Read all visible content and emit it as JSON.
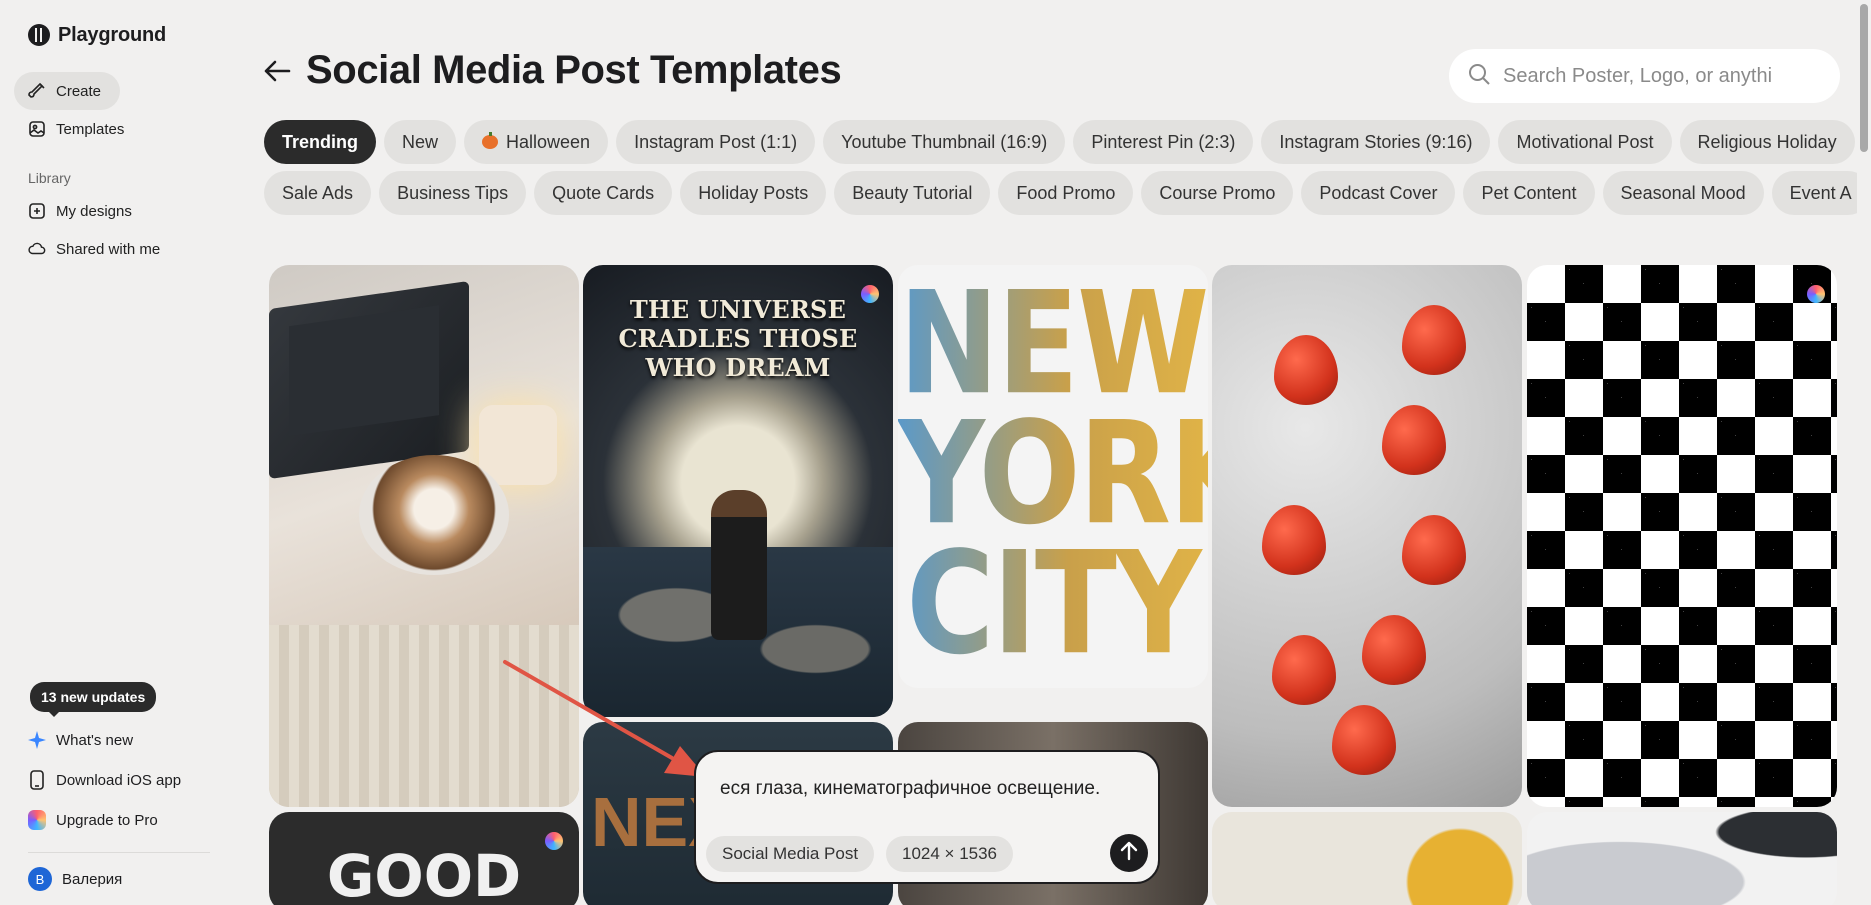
{
  "brand": {
    "name": "Playground"
  },
  "sidebar": {
    "create_label": "Create",
    "templates_label": "Templates",
    "library_label": "Library",
    "my_designs_label": "My designs",
    "shared_label": "Shared with me",
    "updates_badge": "13 new updates",
    "whats_new_label": "What's new",
    "ios_label": "Download iOS app",
    "upgrade_label": "Upgrade to Pro",
    "user": {
      "initial": "B",
      "name": "Валерия"
    }
  },
  "header": {
    "title": "Social Media Post Templates"
  },
  "search": {
    "placeholder": "Search Poster, Logo, or anythi"
  },
  "chips_row1": [
    "Trending",
    "New",
    "Halloween",
    "Instagram Post (1:1)",
    "Youtube Thumbnail (16:9)",
    "Pinterest Pin (2:3)",
    "Instagram Stories (9:16)",
    "Motivational Post",
    "Religious Holiday"
  ],
  "chips_row2": [
    "Sale Ads",
    "Business Tips",
    "Quote Cards",
    "Holiday Posts",
    "Beauty Tutorial",
    "Food Promo",
    "Course Promo",
    "Podcast Cover",
    "Pet Content",
    "Seasonal Mood",
    "Event A"
  ],
  "active_chip": "Trending",
  "cards": {
    "universe_title": "THE UNIVERSE CRADLES THOSE WHO DREAM",
    "ny_line1": "NEW",
    "ny_line2": "YORK",
    "ny_line3": "CITY",
    "good_text": "GOOD",
    "next_text": "NEX"
  },
  "prompt": {
    "text": "еся глаза, кинематографичное освещение.",
    "tag_type": "Social Media Post",
    "tag_size": "1024 × 1536"
  },
  "colors": {
    "accent_dark": "#2b2b2b",
    "arrow_red": "#e05545",
    "avatar_blue": "#1e66d6"
  }
}
